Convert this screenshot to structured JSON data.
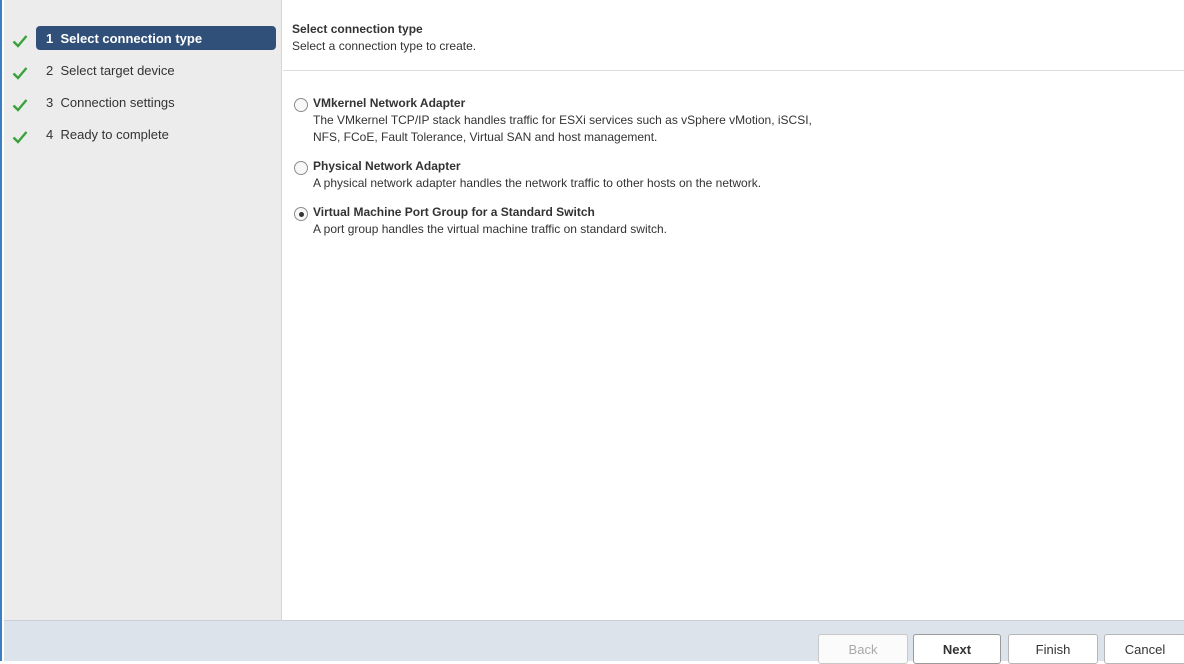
{
  "steps": [
    {
      "number": "1",
      "label": "Select connection type",
      "active": true
    },
    {
      "number": "2",
      "label": "Select target device",
      "active": false
    },
    {
      "number": "3",
      "label": "Connection settings",
      "active": false
    },
    {
      "number": "4",
      "label": "Ready to complete",
      "active": false
    }
  ],
  "header": {
    "title": "Select connection type",
    "subtitle": "Select a connection type to create."
  },
  "options": [
    {
      "title": "VMkernel Network Adapter",
      "description_line1": "The VMkernel TCP/IP stack handles traffic for  ESXi services such as vSphere vMotion, iSCSI,",
      "description_line2": "NFS, FCoE, Fault Tolerance, Virtual SAN and host management.",
      "selected": false
    },
    {
      "title": "Physical Network Adapter",
      "description_line1": "A physical network adapter handles the network traffic to other hosts on the network.",
      "selected": false
    },
    {
      "title": "Virtual Machine Port Group for a Standard Switch",
      "description_line1": "A port group handles the virtual machine traffic on standard switch.",
      "selected": true
    }
  ],
  "footer": {
    "back_label": "Back",
    "next_label": "Next",
    "finish_label": "Finish",
    "cancel_label": "Cancel"
  },
  "icons": {
    "check": "check-icon",
    "radio": "radio-button"
  },
  "colors": {
    "check_green": "#3aa23a",
    "active_step_bg": "#315079",
    "sidebar_bg": "#ececec",
    "footer_bg": "#dde3ea"
  }
}
